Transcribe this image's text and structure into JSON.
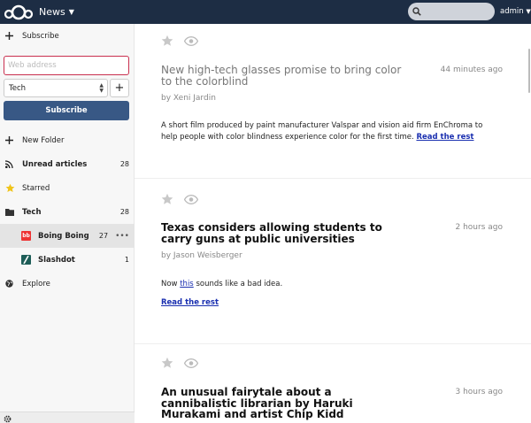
{
  "header": {
    "app_title": "News",
    "user_label": "admin",
    "search_placeholder": "",
    "background": "#1d2d44"
  },
  "sidebar": {
    "subscribe_label": "Subscribe",
    "url_placeholder": "Web address",
    "folder_selected": "Tech",
    "add_folder_symbol": "+",
    "subscribe_button": "Subscribe",
    "new_folder_label": "New Folder",
    "unread_label": "Unread articles",
    "unread_count": "28",
    "starred_label": "Starred",
    "folder_tech_label": "Tech",
    "folder_tech_count": "28",
    "feed_boingboing_label": "Boing Boing",
    "feed_boingboing_count": "27",
    "feed_boingboing_icon": "bb",
    "feed_slashdot_label": "Slashdot",
    "feed_slashdot_count": "1",
    "explore_label": "Explore",
    "more_symbol": "•••"
  },
  "articles": [
    {
      "title": "New high-tech glasses promise to bring color to the colorblind",
      "time": "44 minutes ago",
      "author": "by Xeni Jardin",
      "body": "A short film produced by paint manufacturer Valspar and vision aid firm EnChroma to help people with color blindness experience color for the first time.",
      "read_more": "Read the rest"
    },
    {
      "title": "Texas considers allowing students to carry guns at public universities",
      "time": "2 hours ago",
      "author": "by Jason Weisberger",
      "body_prefix": "Now",
      "body_link": "this",
      "body_suffix": "sounds like a bad idea.",
      "read_more": "Read the rest"
    },
    {
      "title": "An unusual fairytale about a cannibalistic librarian by Haruki Murakami and artist Chip Kidd",
      "time": "3 hours ago"
    }
  ],
  "colors": {
    "accent_button": "#385885",
    "input_focus_border": "#c9304f",
    "star": "#f0c419",
    "link": "#1a2fb0"
  }
}
